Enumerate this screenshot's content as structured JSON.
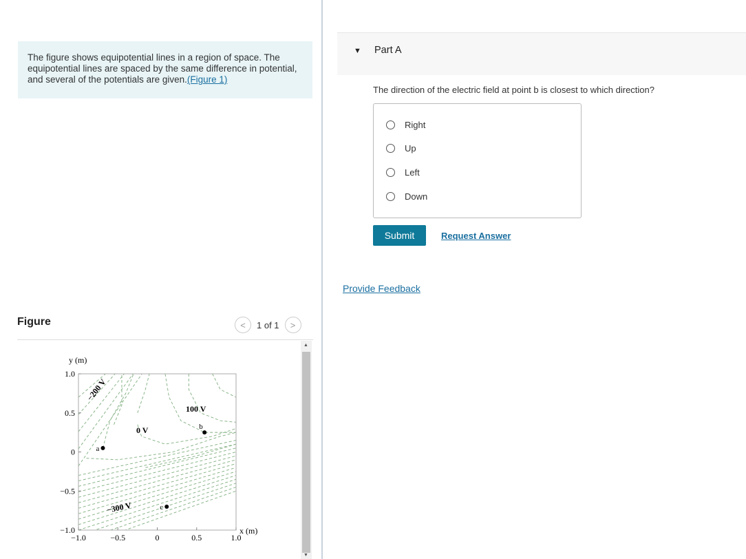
{
  "intro": {
    "text": "The figure shows equipotential lines in a region of space. The equipotential lines are spaced by the same difference in potential, and several of the potentials are given.",
    "link": "(Figure 1)"
  },
  "figure": {
    "title": "Figure",
    "pager": "1 of 1",
    "prev_icon": "chevron-left-icon",
    "next_icon": "chevron-right-icon",
    "ylabel": "y (m)",
    "xlabel": "x (m)",
    "xticks": [
      "−1.0",
      "−0.5",
      "0",
      "0.5",
      "1.0"
    ],
    "yticks": [
      "1.0",
      "0.5",
      "0",
      "−0.5",
      "−1.0"
    ],
    "labels": [
      {
        "text": "−200 V"
      },
      {
        "text": "100 V"
      },
      {
        "text": "0 V"
      },
      {
        "text": "−300 V"
      }
    ],
    "points": [
      {
        "name": "a",
        "x": -0.69,
        "y": 0.05
      },
      {
        "name": "b",
        "x": 0.6,
        "y": 0.25
      },
      {
        "name": "c",
        "x": 0.12,
        "y": -0.7
      }
    ],
    "line_color": "#7fae7f"
  },
  "part": {
    "label": "Part A",
    "question": "The direction of the electric field at point b is closest to which direction?",
    "choices": [
      "Right",
      "Up",
      "Left",
      "Down"
    ],
    "submit": "Submit",
    "request": "Request Answer"
  },
  "feedback": "Provide Feedback",
  "colors": {
    "accent": "#0f7a99",
    "link": "#1a6fa0",
    "intro_bg": "#e8f4f6"
  }
}
